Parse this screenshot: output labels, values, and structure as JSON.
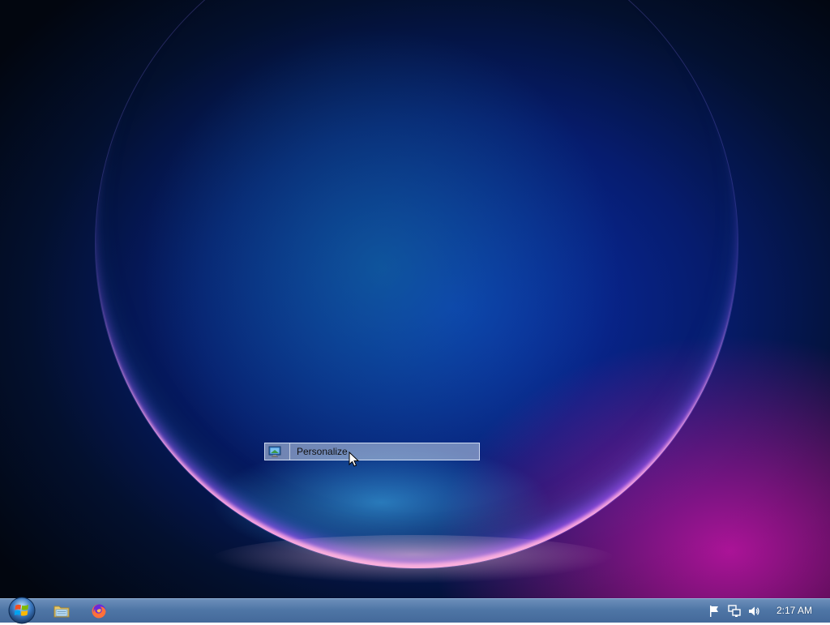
{
  "desktop": {
    "context_menu": {
      "items": [
        {
          "label": "Personalize",
          "icon": "personalize-icon"
        }
      ]
    }
  },
  "taskbar": {
    "start_button": {
      "icon": "windows-start-orb-icon"
    },
    "pinned_apps": [
      {
        "name": "file-explorer",
        "icon": "folder-icon"
      },
      {
        "name": "firefox",
        "icon": "firefox-icon"
      }
    ],
    "tray": {
      "icons": [
        "action-center-flag-icon",
        "network-icon",
        "volume-icon"
      ],
      "clock": "2:17 AM"
    }
  },
  "colors": {
    "taskbar": "#4f76a6",
    "menu_highlight": "#c8d7eb",
    "wallpaper_base": "#061c6e"
  }
}
